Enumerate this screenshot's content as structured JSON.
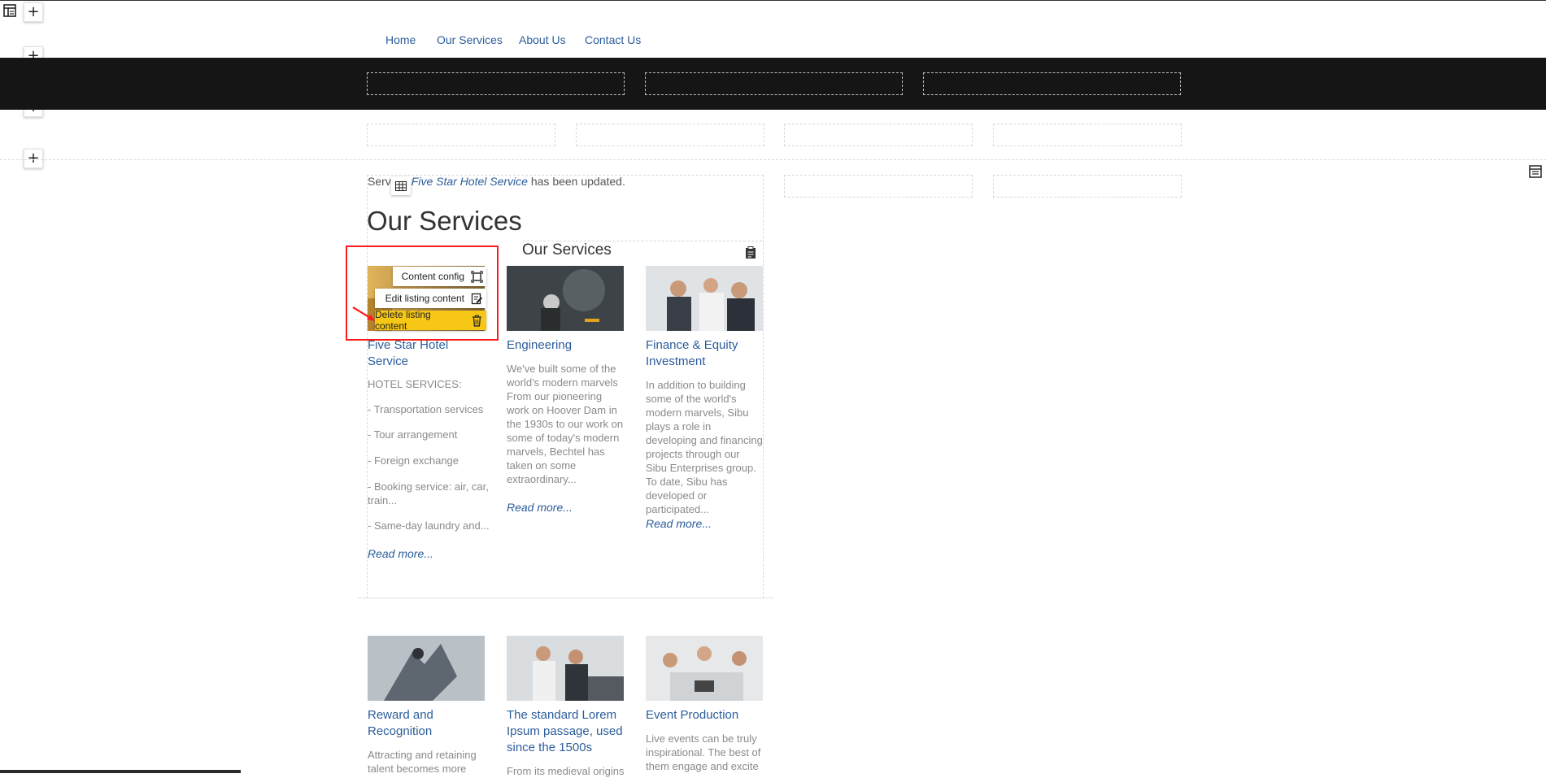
{
  "nav": {
    "items": [
      "Home",
      "Our Services",
      "About Us",
      "Contact Us"
    ]
  },
  "editor": {
    "layout_icon": "layout-icon",
    "add_row_label": "+",
    "grid_icon": "grid-edit-icon",
    "right_icon": "layout-config-icon",
    "clipboard_icon": "clipboard-icon"
  },
  "notice": {
    "prefix": "Serv",
    "link": "Five Star Hotel Service",
    "suffix": " has been updated."
  },
  "page_title": "Our Services",
  "listing_title": "Our Services",
  "context_menu": {
    "items": [
      {
        "label": "Content config",
        "icon": "content-config-icon"
      },
      {
        "label": "Edit listing content",
        "icon": "edit-content-icon"
      },
      {
        "label": "Delete listing content",
        "icon": "trash-icon"
      }
    ],
    "active_index": 2,
    "highlight_color": "#f6c715",
    "annotation_color": "#ff1b1b"
  },
  "services": [
    {
      "title": "Five Star Hotel Service",
      "items": [
        "HOTEL SERVICES:",
        "- Transportation services",
        "- Tour arrangement",
        "- Foreign exchange",
        "- Booking service: air, car, train...",
        "- Same-day laundry and..."
      ],
      "read_more": "Read more..."
    },
    {
      "title": "Engineering",
      "text": "We've built some of the world's modern marvels From our pioneering work on Hoover Dam in the 1930s to our work on some of today's modern marvels, Bechtel has taken on some extraordinary...",
      "read_more": "Read more..."
    },
    {
      "title": "Finance & Equity Investment",
      "text": "In addition to building some of the world's modern marvels, Sibu plays a role in developing and financing projects through our Sibu Enterprises group. To date, Sibu has developed or participated...",
      "read_more": "Read more..."
    },
    {
      "title": "Reward and Recognition",
      "text": "Attracting and retaining talent becomes more"
    },
    {
      "title": "The standard Lorem Ipsum passage, used since the 1500s",
      "text": "From its medieval origins"
    },
    {
      "title": "Event Production",
      "text": "Live events can be truly inspirational. The best of them engage and excite"
    }
  ],
  "colors": {
    "link": "#2b5d9b",
    "dark_band": "#151515"
  }
}
